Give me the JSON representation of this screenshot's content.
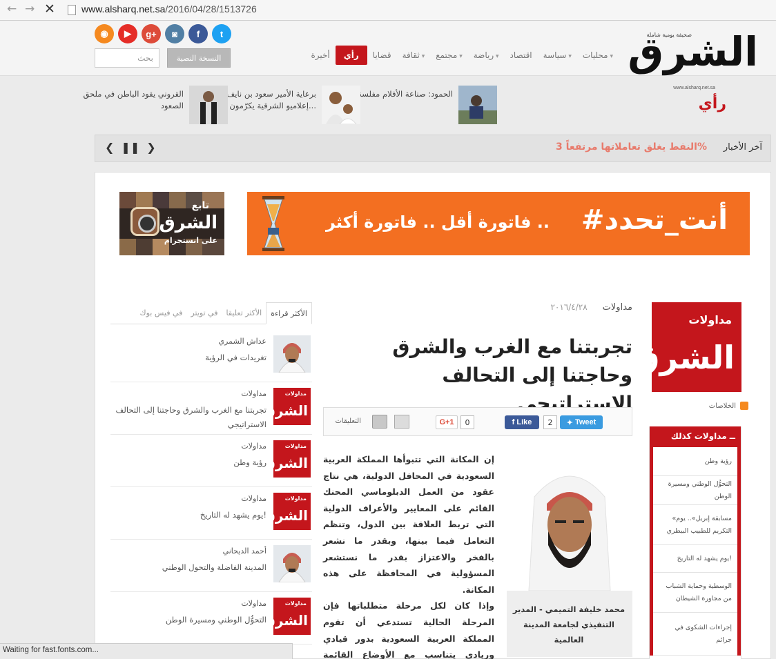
{
  "browser": {
    "url_host": "www.alsharq.net.sa",
    "url_path": "/2016/04/28/1513726",
    "status": "Waiting for fast.fonts.com..."
  },
  "header": {
    "social_icons": [
      {
        "name": "rss-icon",
        "color": "#f5891f",
        "glyph": "◉"
      },
      {
        "name": "youtube-icon",
        "color": "#e52d27",
        "glyph": "▶"
      },
      {
        "name": "googleplus-icon",
        "color": "#dd4b39",
        "glyph": "g+"
      },
      {
        "name": "instagram-icon",
        "color": "#517fa4",
        "glyph": "◙"
      },
      {
        "name": "facebook-icon",
        "color": "#3b5998",
        "glyph": "f"
      },
      {
        "name": "twitter-icon",
        "color": "#1da1f2",
        "glyph": "t"
      }
    ],
    "search_placeholder": "بحث",
    "print_edition": "النسخة النصية",
    "nav": [
      {
        "label": "محليات",
        "sub": true
      },
      {
        "label": "سياسة",
        "sub": true
      },
      {
        "label": "اقتصاد",
        "sub": false
      },
      {
        "label": "رياضة",
        "sub": true
      },
      {
        "label": "مجتمع",
        "sub": true
      },
      {
        "label": "ثقافة",
        "sub": true
      },
      {
        "label": "قضايا",
        "sub": false
      },
      {
        "label": "رأي",
        "sub": false,
        "active": true
      },
      {
        "label": "أخيرة",
        "sub": false
      }
    ],
    "logo_text": "الشرق",
    "logo_tagline": "صحيفة يومية شاملة",
    "logo_url": "www.alsharq.net.sa",
    "section": "رأي"
  },
  "opinions": [
    {
      "title": "الحمود: صناعة الأفلام مفلسة"
    },
    {
      "title": "برعاية الأمير سعود بن نايف .. إعلاميو الشرقية يكرّمون..."
    },
    {
      "title": "القروني يقود الباطن في ملحق الصعود"
    }
  ],
  "ticker": {
    "label": "آخر الأخبار",
    "headline": "النفط يغلق تعاملاتها مرتفعاً 3%"
  },
  "ads": {
    "insta_line1": "تابع",
    "insta_line2": "الشرق",
    "insta_line3": "على انستجرام",
    "banner_hashtag": "#أنت_تحدد",
    "banner_slogan": "فاتورة أقل .. فاتورة أكثر .."
  },
  "right_col": {
    "cat_box_label": "مداولات",
    "cat_box_logo": "الشرق",
    "rss_label": "الخلاصات",
    "list_head": "ــ مداولات كذلك",
    "list_items": [
      "رؤية وطن",
      "التحوُّل الوطني ومسيرة الوطن",
      "«مسابقة إبريل».. يوم التكريم للطبيب البيطري",
      "يوم يشهد له التاريخ!",
      "الوسطية وحماية الشباب من مجاورة الشيطان",
      "إجراءات الشكوى في جرائم"
    ]
  },
  "article": {
    "category": "مداولات",
    "date": "٢٠١٦/٤/٢٨",
    "headline": "تجربتنا مع الغرب والشرق وحاجتنا إلى التحالف الاستراتيجي",
    "tweet": "Tweet",
    "fb_like": "Like",
    "fb_count": "2",
    "gplus": "G+1",
    "gplus_count": "0",
    "comments": "التعليقات",
    "paragraph1": "إن المكانة التي تتبوأها المملكة العربية السعودية في المحافل الدولية، هي نتاج عقود من العمل الدبلوماسي المحنك القائم على المعايير والأعراف الدولية التي تربط العلاقة بين الدول، وتنظم التعامل فيما بينها، وبقدر ما نشعر بالفخر والاعتزاز بقدر ما نستشعر المسؤولية في المحافظة على هذه المكانة.",
    "paragraph2": "وإذا كان لكل مرحلة متطلباتها فإن المرحلة الحالية تستدعي أن تقوم المملكة العربية السعودية بدور قيادي وريادي يتناسب مع الأوضاع القائمة ومعطياتها، ويتناسب مع",
    "author": "محمد خليفة التميمي - المدير التنفيذي لجامعة المدينة العالمية"
  },
  "sidebar": {
    "tabs": [
      {
        "label": "الأكثر قراءة",
        "active": true
      },
      {
        "label": "الأكثر تعليقا"
      },
      {
        "label": "في تويتر"
      },
      {
        "label": "في فيس بوك"
      }
    ],
    "items": [
      {
        "thumb": "person",
        "category": "عداش الشمري",
        "title": "تغريدات في الرؤية"
      },
      {
        "thumb": "logo",
        "category": "مداولات",
        "title": "تجربتنا مع الغرب والشرق وحاجتنا إلى التحالف الاستراتيجي"
      },
      {
        "thumb": "logo",
        "category": "مداولات",
        "title": "رؤية وطن"
      },
      {
        "thumb": "logo",
        "category": "مداولات",
        "title": "يوم يشهد له التاريخ!"
      },
      {
        "thumb": "person",
        "category": "أحمد الديحاني",
        "title": "المدينة الفاضلة والتحول الوطني"
      },
      {
        "thumb": "logo",
        "category": "مداولات",
        "title": "التحوُّل الوطني ومسيرة الوطن"
      }
    ],
    "logo_small_top": "مداولات",
    "logo_small": "الشرق"
  }
}
